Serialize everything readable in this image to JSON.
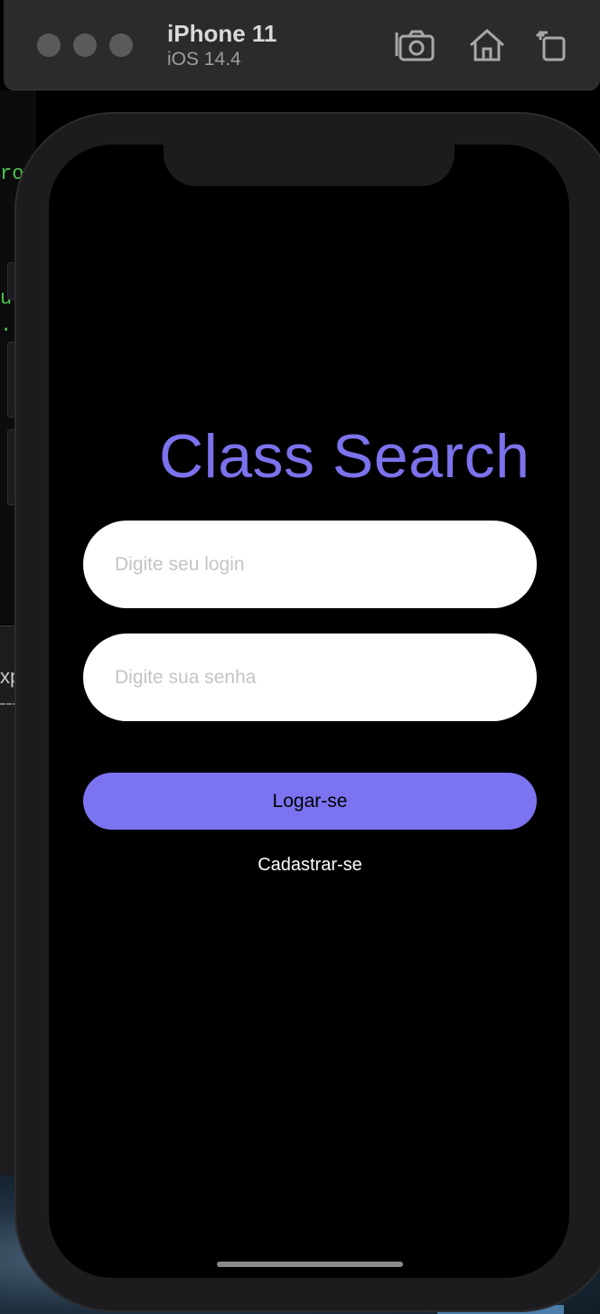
{
  "simulator": {
    "device_name": "iPhone 11",
    "os_version": "iOS 14.4",
    "toolbar_icons": [
      "screenshot-icon",
      "home-icon",
      "rotate-icon"
    ]
  },
  "app": {
    "title": "Class Search",
    "login_placeholder": "Digite seu login",
    "password_placeholder": "Digite sua senha",
    "login_button_label": "Logar-se",
    "register_link_label": "Cadastrar-se"
  },
  "colors": {
    "accent": "#7c73f1",
    "title": "#7b72ec",
    "screen_background": "#000000",
    "field_background": "#ffffff"
  }
}
